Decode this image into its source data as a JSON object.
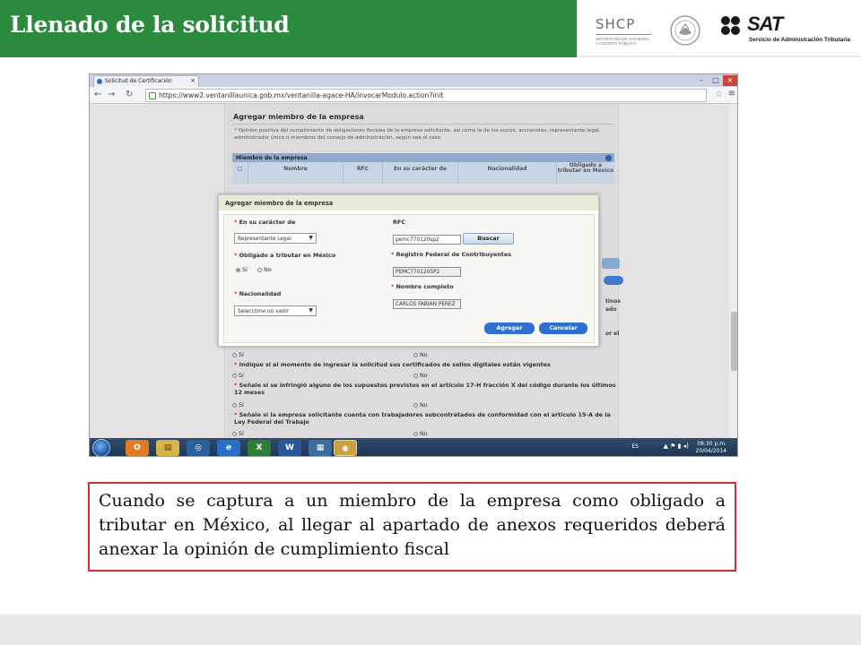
{
  "slide": {
    "title": "Llenado de la solicitud",
    "logos": {
      "shcp": {
        "name": "SHCP",
        "subtitle_line1": "SECRETARÍA DE HACIENDA",
        "subtitle_line2": "Y CRÉDITO PÚBLICO"
      },
      "sat": {
        "name": "SAT",
        "subtitle": "Servicio de Administración Tributaria"
      }
    },
    "caption": "Cuando se captura a un miembro de la empresa como obligado a tributar en México, al llegar al apartado de anexos requeridos deberá anexar la opinión de cumplimiento fiscal",
    "colors": {
      "title_bg": "#2b8a3e",
      "caption_border": "#d42d2d",
      "dialog_button": "#2f6fd0"
    }
  },
  "browser": {
    "tab_label": "Solicitud de Certificación",
    "url": "https://www2.ventanillaunica.gob.mx/ventanilla-agace-HA/invocarModulo.action?init",
    "window_buttons": [
      "–",
      "□",
      "×"
    ]
  },
  "page": {
    "section_title": "Agregar miembro de la empresa",
    "section_note": "* Opinión positiva del cumplimiento de obligaciones fiscales de la empresa solicitante, así como la de los socios, accionistas, representante legal, administrador único o miembros del consejo de administración, según sea el caso.",
    "table": {
      "caption": "Miembro de la empresa",
      "columns": [
        "Nombre",
        "RFC",
        "En su carácter de",
        "Nacionalidad",
        "Obligado a tributar en México"
      ]
    },
    "right_fragments": [
      "tinos",
      "ado",
      "or el"
    ],
    "questions": [
      {
        "text": "Indique si al momento de ingresar la solicitud sus certificados de sellos digitales están vigentes",
        "yes": "Sí",
        "no": "No"
      },
      {
        "text": "Señale si se infringió alguno de los supuestos previstos en el artículo 17-H fracción X del código durante los últimos 12 meses",
        "yes": "Sí",
        "no": "No"
      },
      {
        "text": "Señale si la empresa solicitante cuenta con trabajadores subcontratados de conformidad con el artículo 15-A de la Ley Federal del Trabajo",
        "yes": "Sí",
        "no": "No"
      }
    ],
    "top_radio": {
      "yes": "Sí",
      "no": "No"
    }
  },
  "dialog": {
    "title": "Agregar miembro de la empresa",
    "caracter_label": "En su carácter de",
    "caracter_value": "Representante Legal",
    "obligado_label": "Obligado a tributar en México",
    "obligado_yes": "Sí",
    "obligado_no": "No",
    "nacionalidad_label": "Nacionalidad",
    "nacionalidad_value": "Seleccione un valor",
    "rfc_label": "RFC",
    "rfc_value": "pemc770120sp2",
    "buscar": "Buscar",
    "registro_label": "Registro Federal de Contribuyentes",
    "registro_value": "PEMC770120SP2",
    "nombre_label": "Nombre completo",
    "nombre_value": "CARLOS FABIAN PEREZ",
    "agregar": "Agregar",
    "cancelar": "Cancelar",
    "required_mark": "*"
  },
  "taskbar": {
    "apps": [
      "O",
      "▤",
      "◎",
      "e",
      "X",
      "W",
      "▦",
      "◉"
    ],
    "lang": "ES",
    "time": "08:30 p.m.",
    "date": "20/04/2014"
  }
}
